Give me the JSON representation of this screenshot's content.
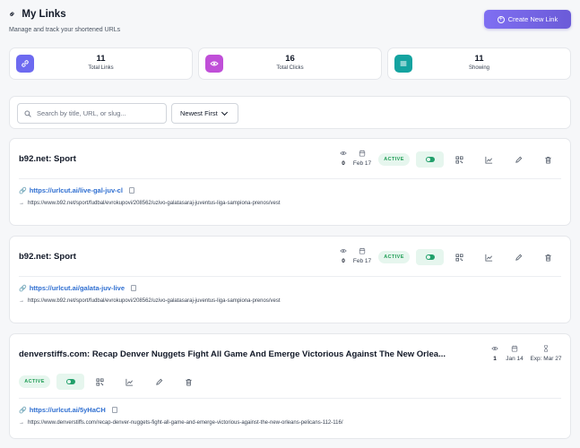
{
  "header": {
    "title": "My Links",
    "subtitle": "Manage and track your shortened URLs",
    "create_label": "Create New Link"
  },
  "stats": [
    {
      "value": "11",
      "label": "Total Links",
      "color": "#6d6af0",
      "icon": "link-icon"
    },
    {
      "value": "16",
      "label": "Total Clicks",
      "color": "#c04fd8",
      "icon": "eye-icon"
    },
    {
      "value": "11",
      "label": "Showing",
      "color": "#14a3a0",
      "icon": "list-icon"
    }
  ],
  "search": {
    "placeholder": "Search by title, URL, or slug...",
    "value": "",
    "sort_selected": "Newest First"
  },
  "links": [
    {
      "title": "b92.net: Sport",
      "clicks": "0",
      "created": "Feb 17",
      "status": "ACTIVE",
      "short_url": "https://urlcut.ai/live-gal-juv-cl",
      "destination": "https://www.b92.net/sport/fudbal/evrokupovi/208562/uzivo-galatasaraj-juventus-liga-sampiona-prenos/vest"
    },
    {
      "title": "b92.net: Sport",
      "clicks": "0",
      "created": "Feb 17",
      "status": "ACTIVE",
      "short_url": "https://urlcut.ai/galata-juv-live",
      "destination": "https://www.b92.net/sport/fudbal/evrokupovi/208562/uzivo-galatasaraj-juventus-liga-sampiona-prenos/vest"
    },
    {
      "title": "denverstiffs.com: Recap Denver Nuggets Fight All Game And Emerge Victorious Against The New Orlea...",
      "clicks": "1",
      "created": "Jan 14",
      "expires": "Exp: Mar 27",
      "status": "ACTIVE",
      "short_url": "https://urlcut.ai/5yHaCH",
      "destination": "https://www.denverstiffs.com/recap-denver-nuggets-fight-all-game-and-emerge-victorious-against-the-new-orleans-pelicans-112-116/"
    }
  ]
}
